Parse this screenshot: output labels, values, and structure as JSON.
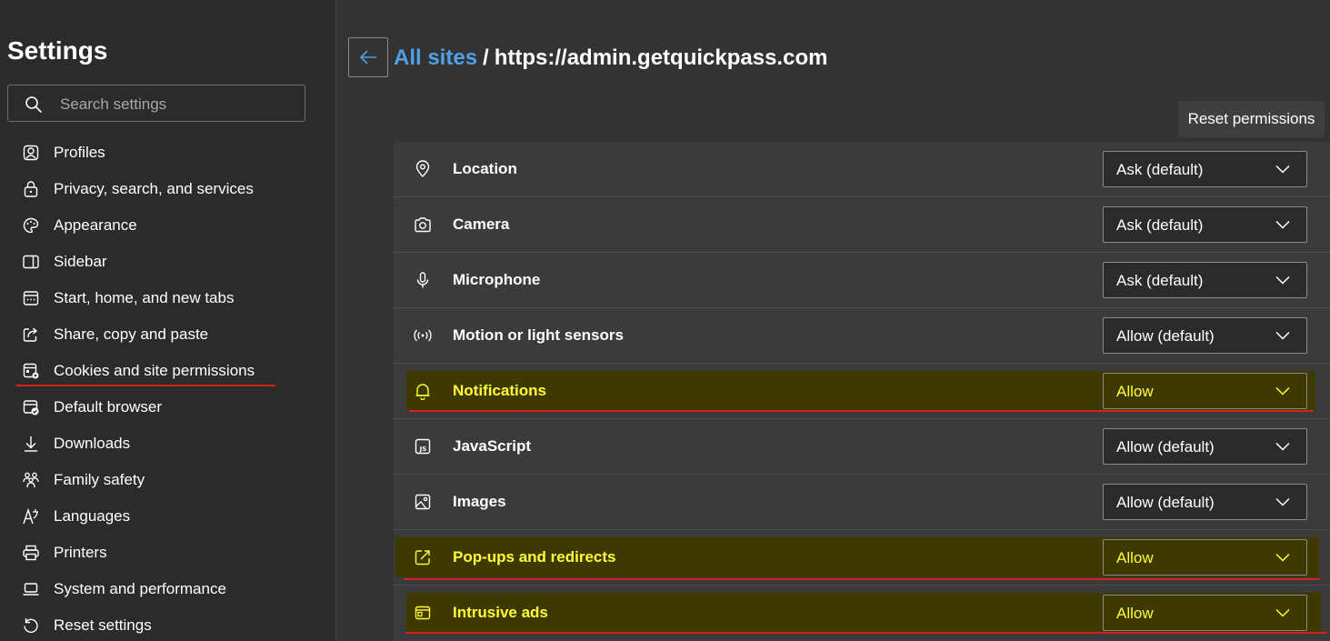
{
  "sidebar": {
    "title": "Settings",
    "search": {
      "placeholder": "Search settings",
      "value": ""
    },
    "items": [
      {
        "label": "Profiles",
        "icon": "profile-icon"
      },
      {
        "label": "Privacy, search, and services",
        "icon": "lock-icon"
      },
      {
        "label": "Appearance",
        "icon": "palette-icon"
      },
      {
        "label": "Sidebar",
        "icon": "sidebar-icon"
      },
      {
        "label": "Start, home, and new tabs",
        "icon": "home-tabs-icon"
      },
      {
        "label": "Share, copy and paste",
        "icon": "share-icon"
      },
      {
        "label": "Cookies and site permissions",
        "icon": "cookies-permissions-icon",
        "active": true
      },
      {
        "label": "Default browser",
        "icon": "default-browser-icon"
      },
      {
        "label": "Downloads",
        "icon": "download-icon"
      },
      {
        "label": "Family safety",
        "icon": "family-icon"
      },
      {
        "label": "Languages",
        "icon": "language-icon"
      },
      {
        "label": "Printers",
        "icon": "printer-icon"
      },
      {
        "label": "System and performance",
        "icon": "laptop-icon"
      },
      {
        "label": "Reset settings",
        "icon": "reset-icon"
      }
    ]
  },
  "header": {
    "back_icon": "arrow-left-icon",
    "breadcrumb_link": "All sites",
    "separator": "/",
    "current_site": "https://admin.getquickpass.com",
    "reset_label": "Reset permissions"
  },
  "permissions": [
    {
      "label": "Location",
      "value": "Ask (default)",
      "icon": "location-pin-icon"
    },
    {
      "label": "Camera",
      "value": "Ask (default)",
      "icon": "camera-icon"
    },
    {
      "label": "Microphone",
      "value": "Ask (default)",
      "icon": "microphone-icon"
    },
    {
      "label": "Motion or light sensors",
      "value": "Allow (default)",
      "icon": "sensor-icon"
    },
    {
      "label": "Notifications",
      "value": "Allow",
      "icon": "bell-icon",
      "highlighted": true
    },
    {
      "label": "JavaScript",
      "value": "Allow (default)",
      "icon": "javascript-icon"
    },
    {
      "label": "Images",
      "value": "Allow (default)",
      "icon": "image-icon"
    },
    {
      "label": "Pop-ups and redirects",
      "value": "Allow",
      "icon": "popup-icon",
      "highlighted": true
    },
    {
      "label": "Intrusive ads",
      "value": "Allow",
      "icon": "ads-icon",
      "highlighted": true
    }
  ],
  "colors": {
    "accent_link": "#4ea0e7",
    "highlight_text": "#ffff33",
    "highlight_bg": "#3d3900",
    "annotation_red": "#d61f1f"
  }
}
